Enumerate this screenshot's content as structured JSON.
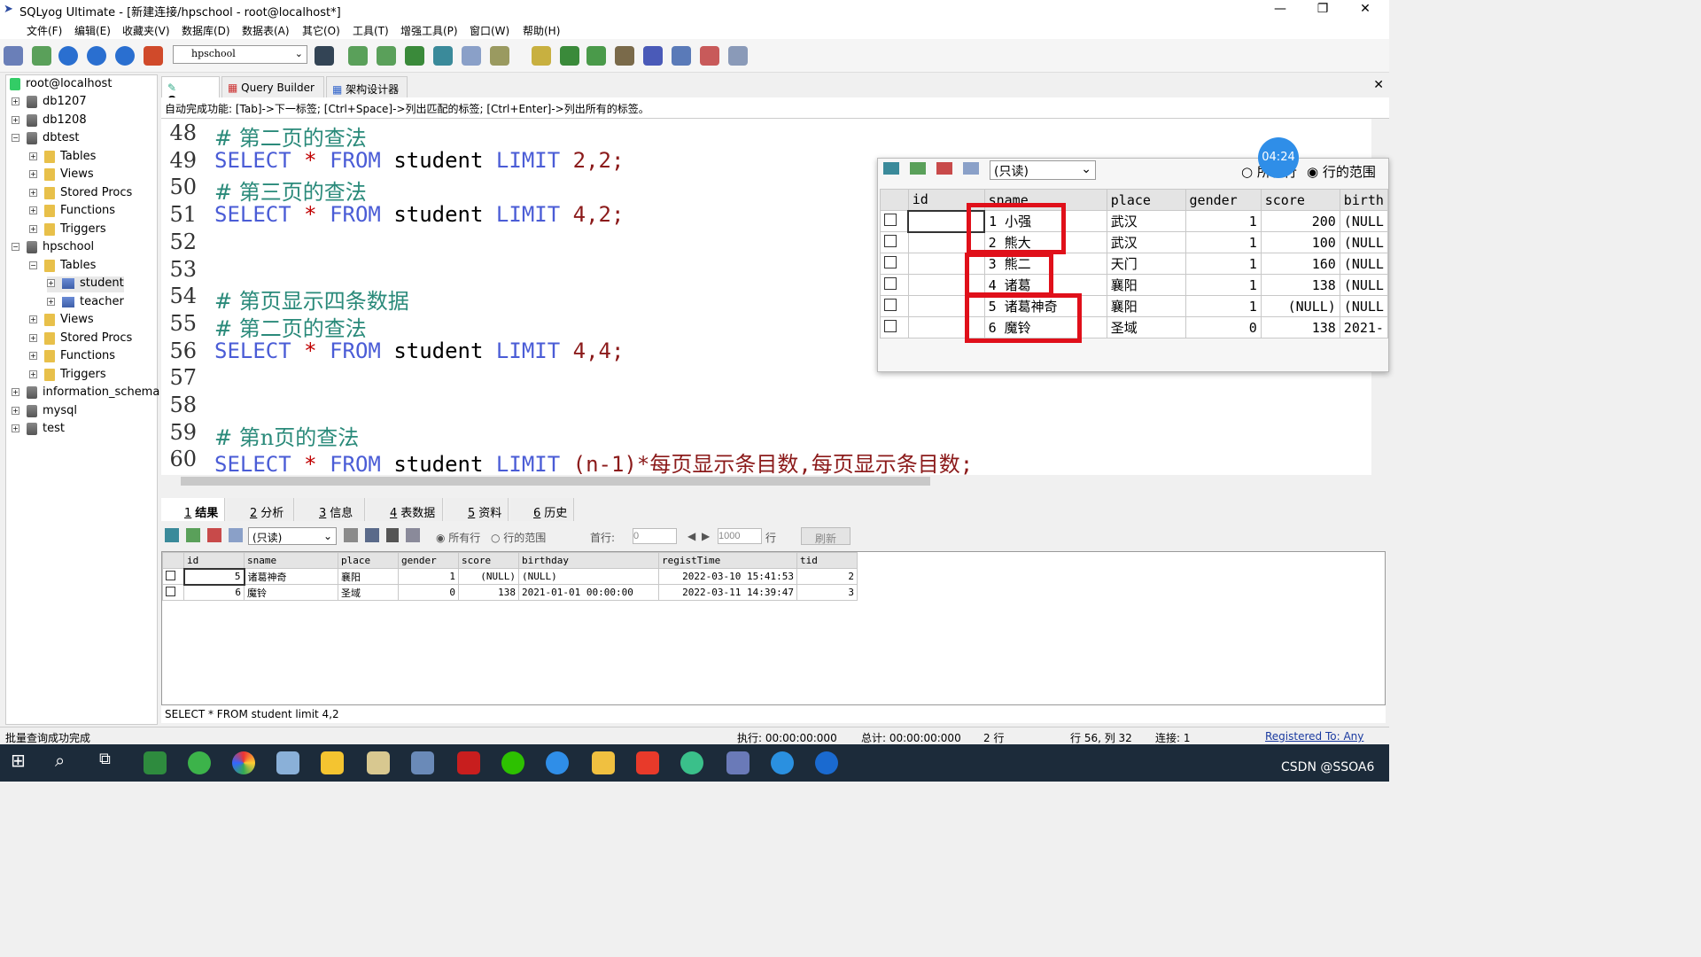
{
  "window": {
    "title": "SQLyog Ultimate - [新建连接/hpschool - root@localhost*]",
    "min": "—",
    "max": "❐",
    "close": "✕"
  },
  "menu": [
    "文件(F)",
    "编辑(E)",
    "收藏夹(V)",
    "数据库(D)",
    "数据表(A)",
    "其它(O)",
    "工具(T)",
    "增强工具(P)",
    "窗口(W)",
    "帮助(H)"
  ],
  "toolbar": {
    "db_select": "hpschool"
  },
  "sidebar": {
    "root": "root@localhost",
    "nodes": [
      {
        "label": "db1207",
        "exp": "+",
        "kind": "db"
      },
      {
        "label": "db1208",
        "exp": "+",
        "kind": "db"
      },
      {
        "label": "dbtest",
        "exp": "−",
        "kind": "db"
      },
      {
        "label": "Tables",
        "exp": "+",
        "kind": "fold"
      },
      {
        "label": "Views",
        "exp": "+",
        "kind": "fold"
      },
      {
        "label": "Stored Procs",
        "exp": "+",
        "kind": "fold"
      },
      {
        "label": "Functions",
        "exp": "+",
        "kind": "fold"
      },
      {
        "label": "Triggers",
        "exp": "+",
        "kind": "fold"
      },
      {
        "label": "hpschool",
        "exp": "−",
        "kind": "db"
      },
      {
        "label": "Tables",
        "exp": "−",
        "kind": "fold"
      },
      {
        "label": "student",
        "exp": "+",
        "kind": "tbl"
      },
      {
        "label": "teacher",
        "exp": "+",
        "kind": "tbl"
      },
      {
        "label": "Views",
        "exp": "+",
        "kind": "fold"
      },
      {
        "label": "Stored Procs",
        "exp": "+",
        "kind": "fold"
      },
      {
        "label": "Functions",
        "exp": "+",
        "kind": "fold"
      },
      {
        "label": "Triggers",
        "exp": "+",
        "kind": "fold"
      },
      {
        "label": "information_schema",
        "exp": "+",
        "kind": "db"
      },
      {
        "label": "mysql",
        "exp": "+",
        "kind": "db"
      },
      {
        "label": "test",
        "exp": "+",
        "kind": "db"
      }
    ]
  },
  "tabs": {
    "query": "Query",
    "builder": "Query Builder",
    "designer": "架构设计器"
  },
  "hint": "自动完成功能: [Tab]->下一标签; [Ctrl+Space]->列出匹配的标签; [Ctrl+Enter]->列出所有的标签。",
  "editor": {
    "lines": [
      {
        "n": "48",
        "t": "# 第二页的查法"
      },
      {
        "n": "49",
        "t": "SELECT * FROM student LIMIT 2,2;"
      },
      {
        "n": "50",
        "t": "# 第三页的查法"
      },
      {
        "n": "51",
        "t": "SELECT * FROM student LIMIT 4,2;"
      },
      {
        "n": "52",
        "t": ""
      },
      {
        "n": "53",
        "t": ""
      },
      {
        "n": "54",
        "t": "# 第页显示四条数据"
      },
      {
        "n": "55",
        "t": "# 第二页的查法"
      },
      {
        "n": "56",
        "t": "SELECT * FROM student LIMIT 4,4;"
      },
      {
        "n": "57",
        "t": ""
      },
      {
        "n": "58",
        "t": ""
      },
      {
        "n": "59",
        "t": "# 第n页的查法"
      },
      {
        "n": "60",
        "t": "SELECT * FROM student LIMIT (n-1)*每页显示条目数,每页显示条目数;"
      }
    ]
  },
  "overlay": {
    "readonly": "(只读)",
    "all_rows": "所有行",
    "row_range": "行的范围",
    "timer": "04:24",
    "columns": [
      "id",
      "sname",
      "place",
      "gender",
      "score",
      "birth"
    ],
    "rows": [
      [
        "",
        "1",
        "小强",
        "武汉",
        "1",
        "200",
        "(NULL"
      ],
      [
        "",
        "2",
        "熊大",
        "武汉",
        "1",
        "100",
        "(NULL"
      ],
      [
        "",
        "3",
        "熊二",
        "天门",
        "1",
        "160",
        "(NULL"
      ],
      [
        "",
        "4",
        "诸葛",
        "襄阳",
        "1",
        "138",
        "(NULL"
      ],
      [
        "",
        "5",
        "诸葛神奇",
        "襄阳",
        "1",
        "(NULL)",
        "(NULL"
      ],
      [
        "",
        "6",
        "魔铃",
        "圣域",
        "0",
        "138",
        "2021-"
      ]
    ]
  },
  "result_tabs": [
    {
      "n": "1",
      "label": "结果"
    },
    {
      "n": "2",
      "label": "分析"
    },
    {
      "n": "3",
      "label": "信息"
    },
    {
      "n": "4",
      "label": "表数据"
    },
    {
      "n": "5",
      "label": "资料"
    },
    {
      "n": "6",
      "label": "历史"
    }
  ],
  "result_toolbar": {
    "readonly": "(只读)",
    "all_rows": "所有行",
    "row_range": "行的范围",
    "first_row_label": "首行:",
    "first_row": "0",
    "limit": "1000",
    "rows_unit": "行",
    "refresh": "刷新"
  },
  "result": {
    "columns": [
      "id",
      "sname",
      "place",
      "gender",
      "score",
      "birthday",
      "registTime",
      "tid"
    ],
    "rows": [
      [
        "5",
        "诸葛神奇",
        "襄阳",
        "1",
        "(NULL)",
        "(NULL)",
        "2022-03-10 15:41:53",
        "2"
      ],
      [
        "6",
        "魔铃",
        "圣域",
        "0",
        "138",
        "2021-01-01 00:00:00",
        "2022-03-11 14:39:47",
        "3"
      ]
    ]
  },
  "sql_line": "SELECT * FROM student limit 4,2",
  "status": {
    "msg": "批量查询成功完成",
    "exec": "执行: 00:00:00:000",
    "total": "总计: 00:00:00:000",
    "rows": "2 行",
    "pos": "行 56, 列 32",
    "conn": "连接: 1",
    "reg": "Registered To: Any"
  },
  "watermark": "CSDN @SSOA6",
  "colors": {
    "keyword": "#4a5cd6",
    "comment": "#2a8a7a",
    "highlight": "#e0101a",
    "taskbar": "#1c2b3a"
  }
}
